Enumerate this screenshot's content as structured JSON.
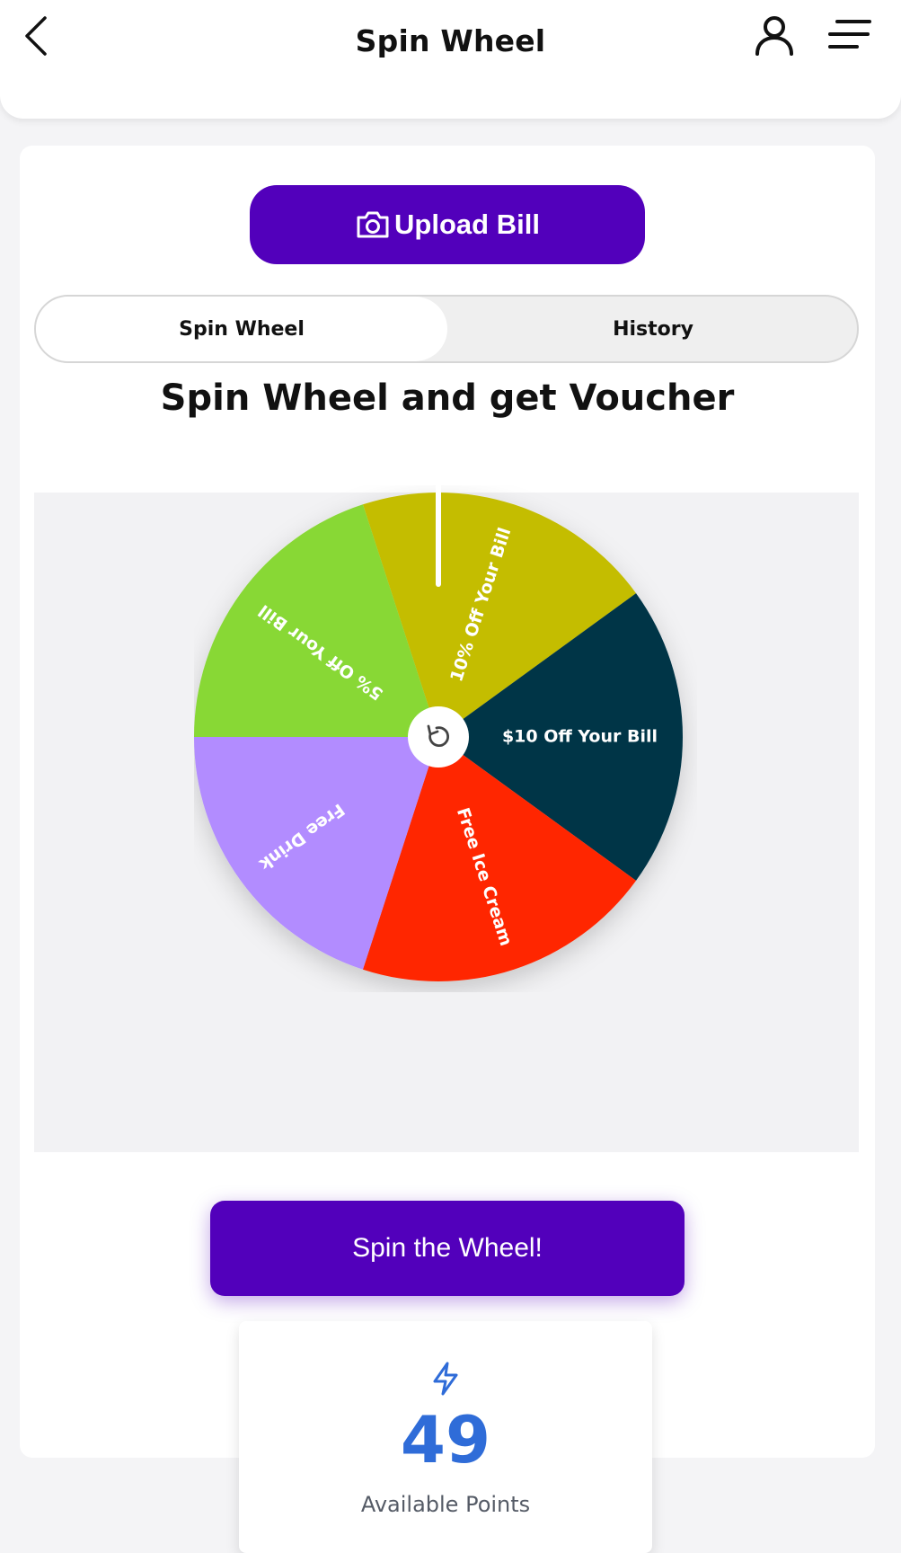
{
  "header": {
    "title": "Spin Wheel",
    "back_icon": "chevron-left-icon",
    "user_icon": "user-icon",
    "menu_icon": "menu-icon"
  },
  "upload": {
    "label": "Upload Bill",
    "icon": "camera-icon"
  },
  "tabs": [
    {
      "label": "Spin Wheel",
      "active": true
    },
    {
      "label": "History",
      "active": false
    }
  ],
  "section_title": "Spin Wheel and get Voucher",
  "wheel": {
    "segments": [
      {
        "label": "10% Off Your Bill",
        "color": "#c4bd00"
      },
      {
        "label": "$10 Off Your Bill",
        "color": "#003447"
      },
      {
        "label": "Free Ice Cream",
        "color": "#ff2600"
      },
      {
        "label": "Free Drink",
        "color": "#b28cff"
      },
      {
        "label": "5% Off Your Bill",
        "color": "#88d834"
      }
    ],
    "center_icon": "refresh-icon"
  },
  "spin_button": {
    "label": "Spin the Wheel!"
  },
  "points": {
    "value": "49",
    "label": "Available Points",
    "icon": "lightning-icon"
  },
  "colors": {
    "primary": "#5200bb",
    "points_blue": "#2f6cd8"
  }
}
